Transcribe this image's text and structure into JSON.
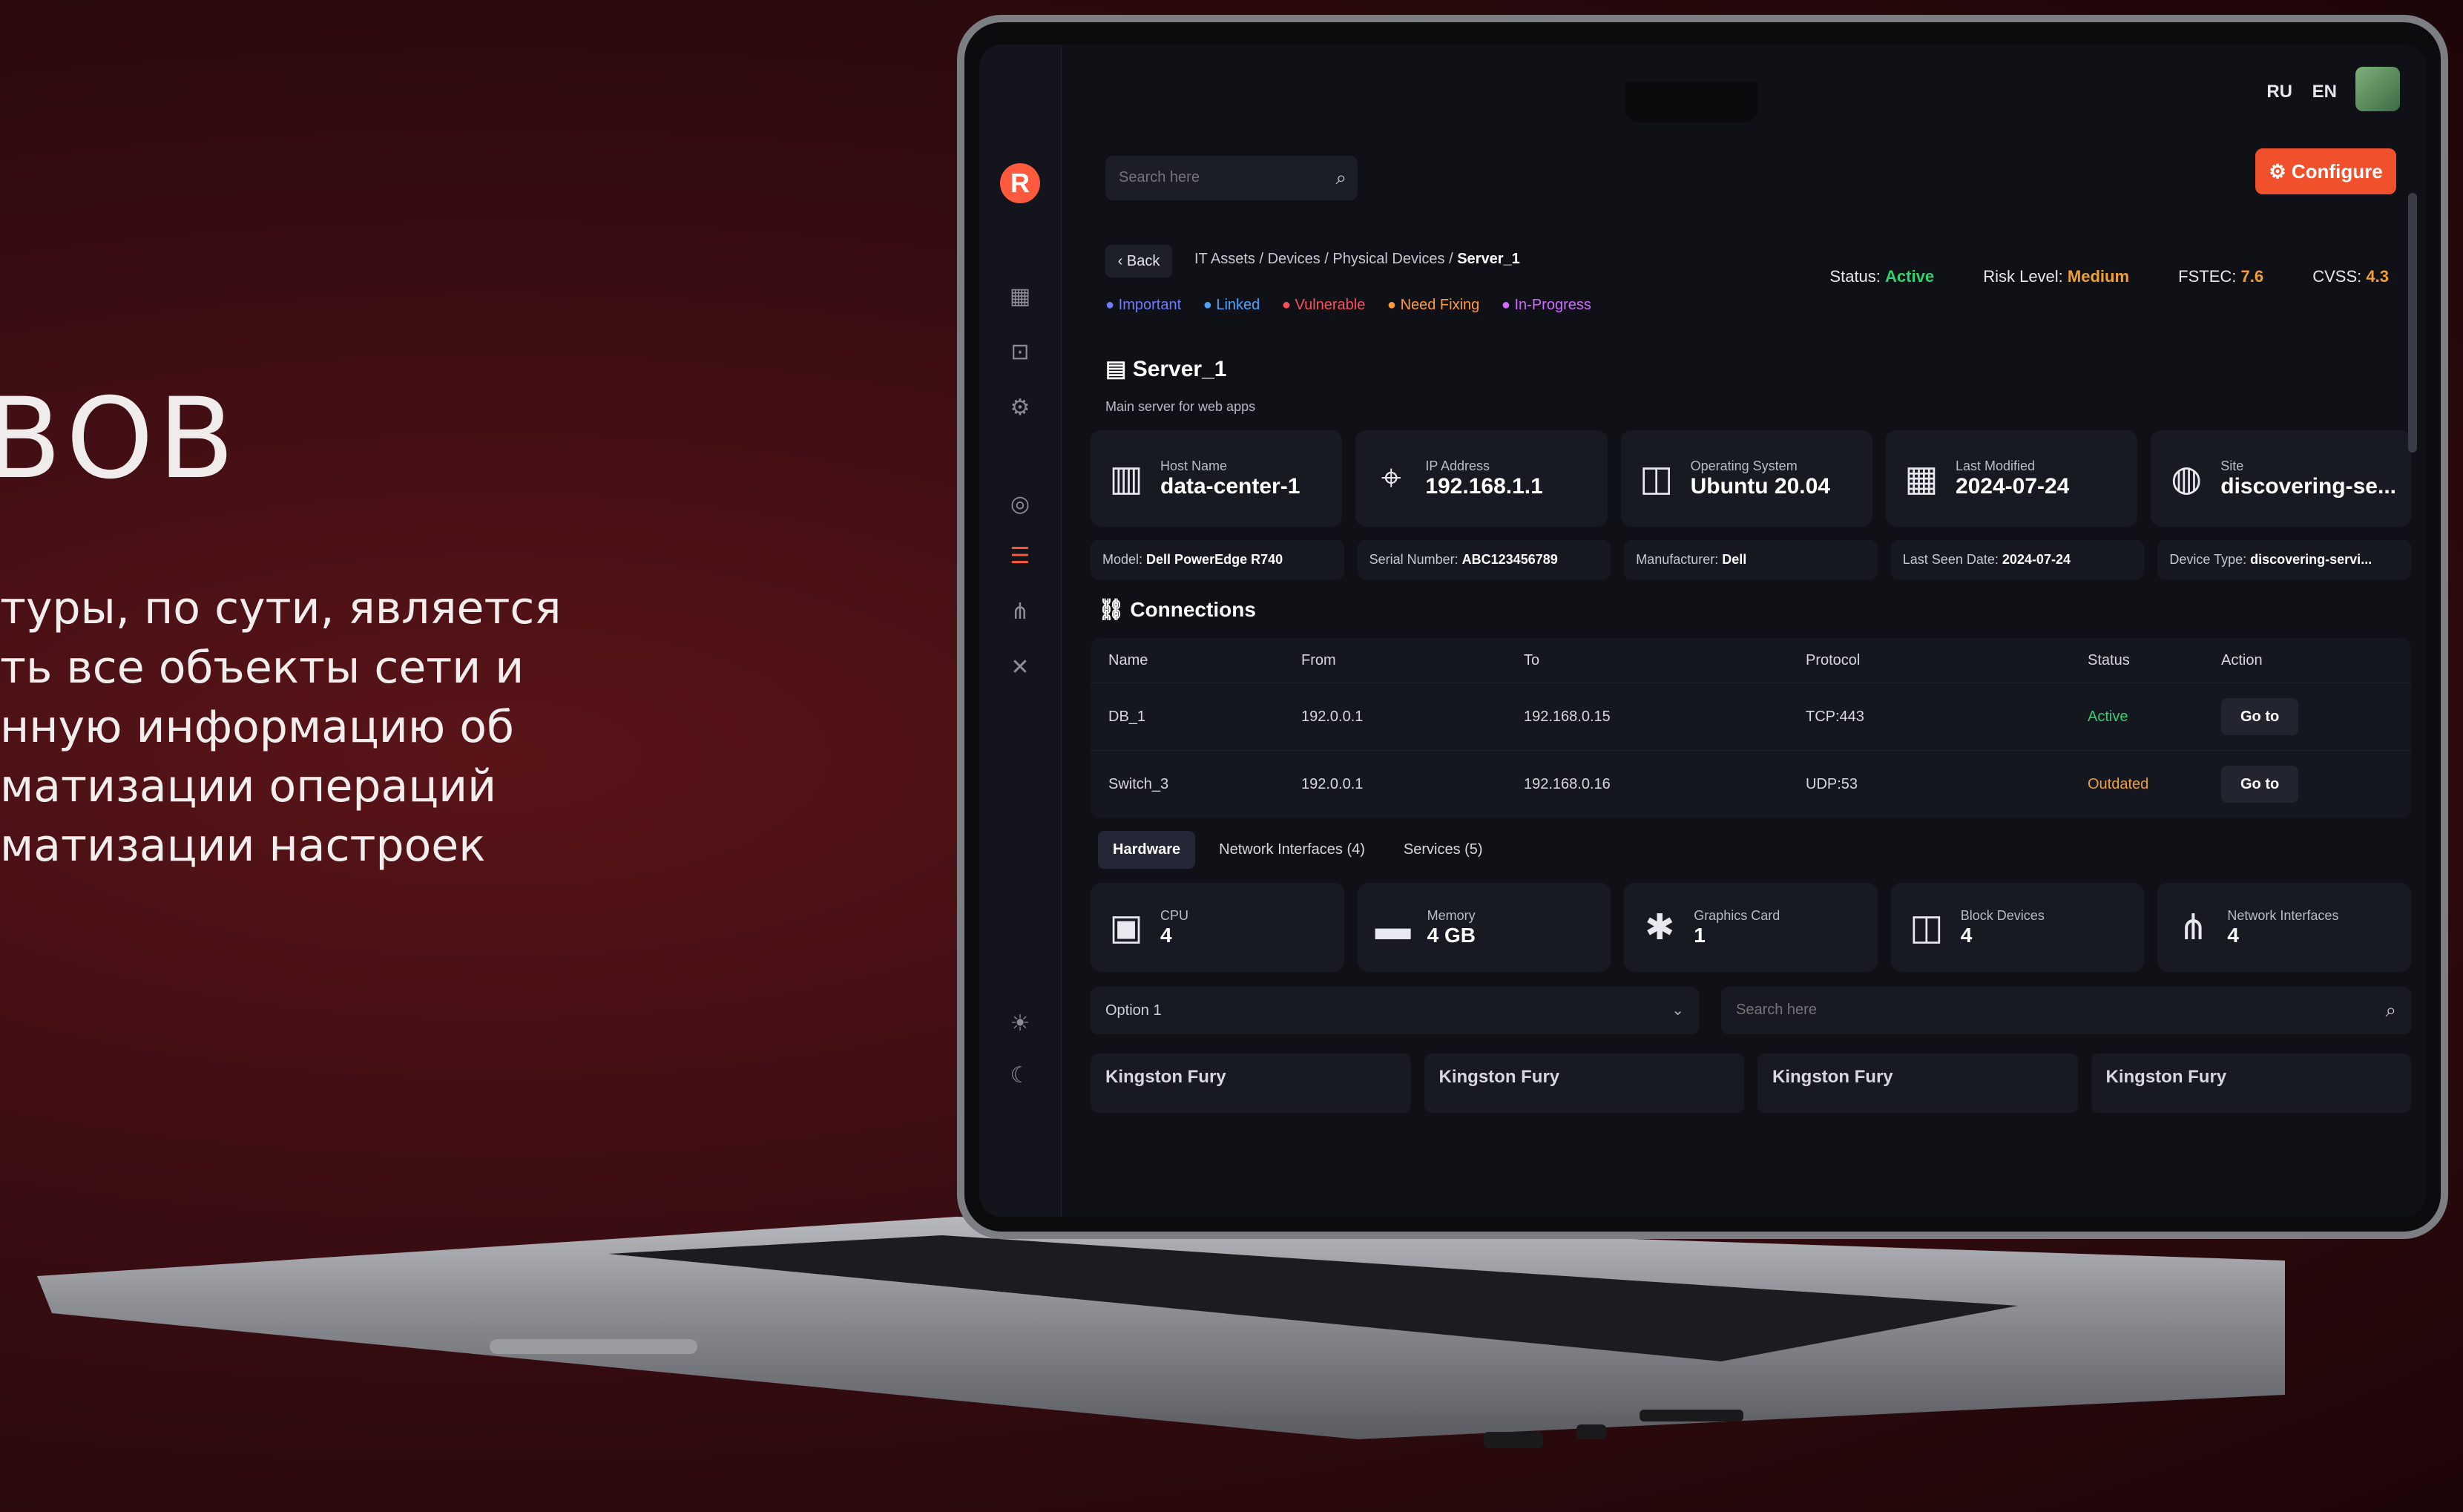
{
  "promo": {
    "title": "ВОВ",
    "lines": [
      "туры, по сути, является",
      "ть все объекты сети и",
      "нную информацию об",
      "матизации операций",
      "матизации настроек"
    ]
  },
  "app": {
    "search_placeholder": "Search here",
    "languages": [
      "RU",
      "EN"
    ],
    "configure_label": "Configure",
    "back_label": "Back",
    "breadcrumb": [
      "IT Assets",
      "Devices",
      "Physical Devices",
      "Server_1"
    ],
    "tags": [
      {
        "label": "Important",
        "color": "#6f7cff"
      },
      {
        "label": "Linked",
        "color": "#4aa3ff"
      },
      {
        "label": "Vulnerable",
        "color": "#ff4d5a"
      },
      {
        "label": "Need Fixing",
        "color": "#ff9a3c"
      },
      {
        "label": "In-Progress",
        "color": "#d16bff"
      }
    ],
    "status": {
      "status_label": "Status:",
      "status_value": "Active",
      "risk_label": "Risk Level:",
      "risk_value": "Medium",
      "fstec_label": "FSTEC:",
      "fstec_value": "7.6",
      "cvss_label": "CVSS:",
      "cvss_value": "4.3"
    },
    "device": {
      "title": "Server_1",
      "subtitle": "Main server for web apps"
    },
    "info_cards": [
      {
        "icon": "server-icon",
        "label": "Host Name",
        "value": "data-center-1"
      },
      {
        "icon": "location-pin-icon",
        "label": "IP Address",
        "value": "192.168.1.1"
      },
      {
        "icon": "disk-icon",
        "label": "Operating System",
        "value": "Ubuntu 20.04"
      },
      {
        "icon": "calendar-icon",
        "label": "Last Modified",
        "value": "2024-07-24"
      },
      {
        "icon": "globe-icon",
        "label": "Site",
        "value": "discovering-se..."
      }
    ],
    "meta": [
      {
        "label": "Model:",
        "value": "Dell PowerEdge R740"
      },
      {
        "label": "Serial Number:",
        "value": "ABC123456789"
      },
      {
        "label": "Manufacturer:",
        "value": "Dell"
      },
      {
        "label": "Last Seen Date:",
        "value": "2024-07-24"
      },
      {
        "label": "Device Type:",
        "value": "discovering-servi..."
      }
    ],
    "connections": {
      "title": "Connections",
      "headers": [
        "Name",
        "From",
        "To",
        "Protocol",
        "Status",
        "Action"
      ],
      "rows": [
        {
          "name": "DB_1",
          "from": "192.0.0.1",
          "to": "192.168.0.15",
          "protocol": "TCP:443",
          "status": "Active",
          "status_color": "#2fd36b",
          "action": "Go to"
        },
        {
          "name": "Switch_3",
          "from": "192.0.0.1",
          "to": "192.168.0.16",
          "protocol": "UDP:53",
          "status": "Outdated",
          "status_color": "#f0a030",
          "action": "Go to"
        }
      ]
    },
    "tabs": [
      "Hardware",
      "Network Interfaces (4)",
      "Services (5)"
    ],
    "hardware": [
      {
        "icon": "cpu-icon",
        "label": "CPU",
        "value": "4"
      },
      {
        "icon": "memory-icon",
        "label": "Memory",
        "value": "4 GB"
      },
      {
        "icon": "graphics-card-icon",
        "label": "Graphics Card",
        "value": "1"
      },
      {
        "icon": "block-device-icon",
        "label": "Block Devices",
        "value": "4"
      },
      {
        "icon": "network-icon",
        "label": "Network Interfaces",
        "value": "4"
      }
    ],
    "option_select": "Option 1",
    "search2_placeholder": "Search here",
    "bottom_cards": [
      "Kingston Fury",
      "Kingston Fury",
      "Kingston Fury",
      "Kingston Fury"
    ]
  }
}
